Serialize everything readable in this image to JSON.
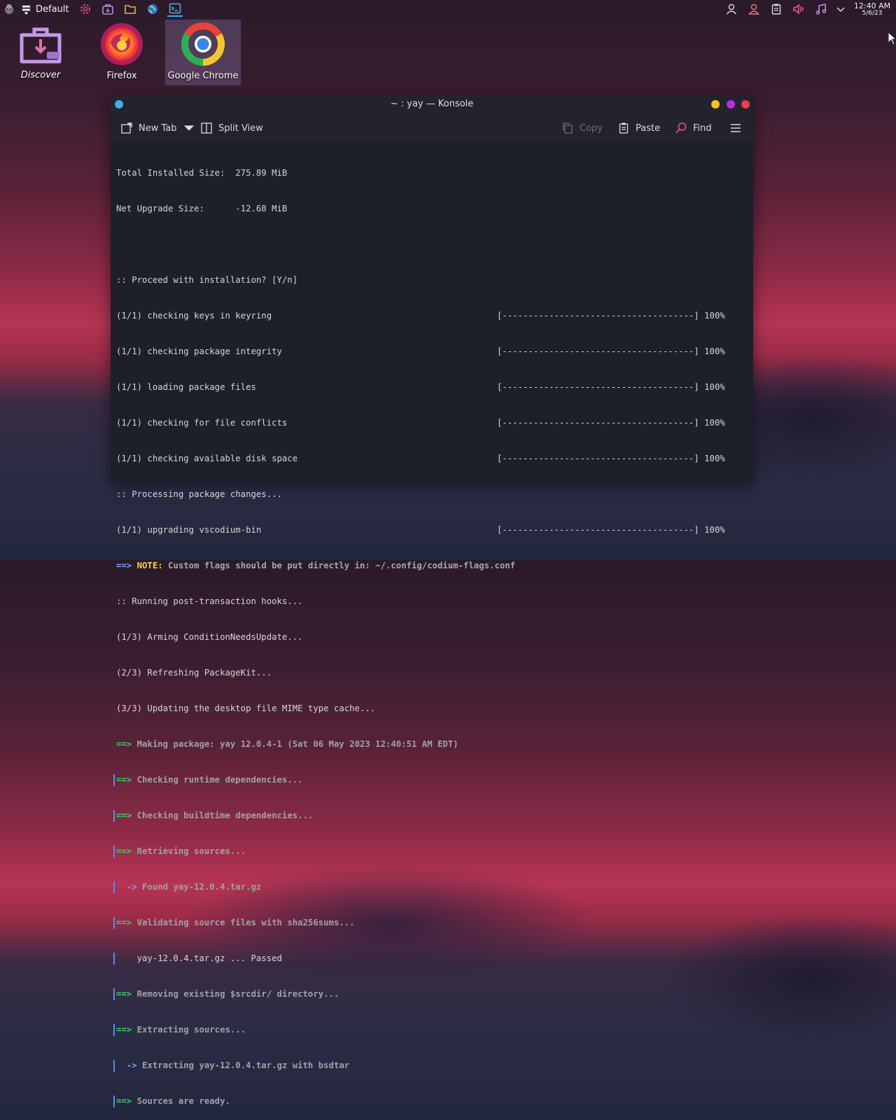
{
  "panel": {
    "activity_label": "Default",
    "clock_time": "12:40 AM",
    "clock_date": "5/6/23"
  },
  "desktop": {
    "icons": [
      {
        "label": "Discover"
      },
      {
        "label": "Firefox"
      },
      {
        "label": "Google Chrome"
      }
    ]
  },
  "window": {
    "title": "~ : yay — Konsole",
    "toolbar": {
      "new_tab": "New Tab",
      "split_view": "Split View",
      "copy": "Copy",
      "paste": "Paste",
      "find": "Find"
    }
  },
  "terminal": {
    "lines": [
      {
        "text": "Total Installed Size:  275.89 MiB",
        "bar": ""
      },
      {
        "text": "Net Upgrade Size:      -12.68 MiB",
        "bar": ""
      },
      {
        "text": "",
        "bar": ""
      },
      {
        "text": ":: Proceed with installation? [Y/n]",
        "bar": ""
      },
      {
        "text": "(1/1) checking keys in keyring",
        "bar": "[-------------------------------------] 100%"
      },
      {
        "text": "(1/1) checking package integrity",
        "bar": "[-------------------------------------] 100%"
      },
      {
        "text": "(1/1) loading package files",
        "bar": "[-------------------------------------] 100%"
      },
      {
        "text": "(1/1) checking for file conflicts",
        "bar": "[-------------------------------------] 100%"
      },
      {
        "text": "(1/1) checking available disk space",
        "bar": "[-------------------------------------] 100%"
      },
      {
        "text": ":: Processing package changes...",
        "bar": ""
      },
      {
        "text": "(1/1) upgrading vscodium-bin",
        "bar": "[-------------------------------------] 100%"
      }
    ],
    "note_prefix": "==>",
    "note_label": "NOTE:",
    "note_text": " Custom flags should be put directly in: ~/.config/codium-flags.conf",
    "lines2": [
      ":: Running post-transaction hooks...",
      "(1/3) Arming ConditionNeedsUpdate...",
      "(2/3) Refreshing PackageKit...",
      "(3/3) Updating the desktop file MIME type cache..."
    ],
    "make": {
      "arrow": "==>",
      "making": " Making package: yay 12.0.4-1 (Sat 06 May 2023 12:40:51 AM EDT)",
      "runtime": " Checking runtime dependencies...",
      "buildtime": " Checking buildtime dependencies...",
      "retrieving": " Retrieving sources...",
      "sub_arrow": "  ->",
      "found": " Found yay-12.0.4.tar.gz",
      "validating": " Validating source files with sha256sums...",
      "passed": "    yay-12.0.4.tar.gz ... Passed",
      "removing": " Removing existing $srcdir/ directory...",
      "extracting": " Extracting sources...",
      "extracting_file": " Extracting yay-12.0.4.tar.gz with bsdtar",
      "ready": " Sources are ready."
    }
  }
}
